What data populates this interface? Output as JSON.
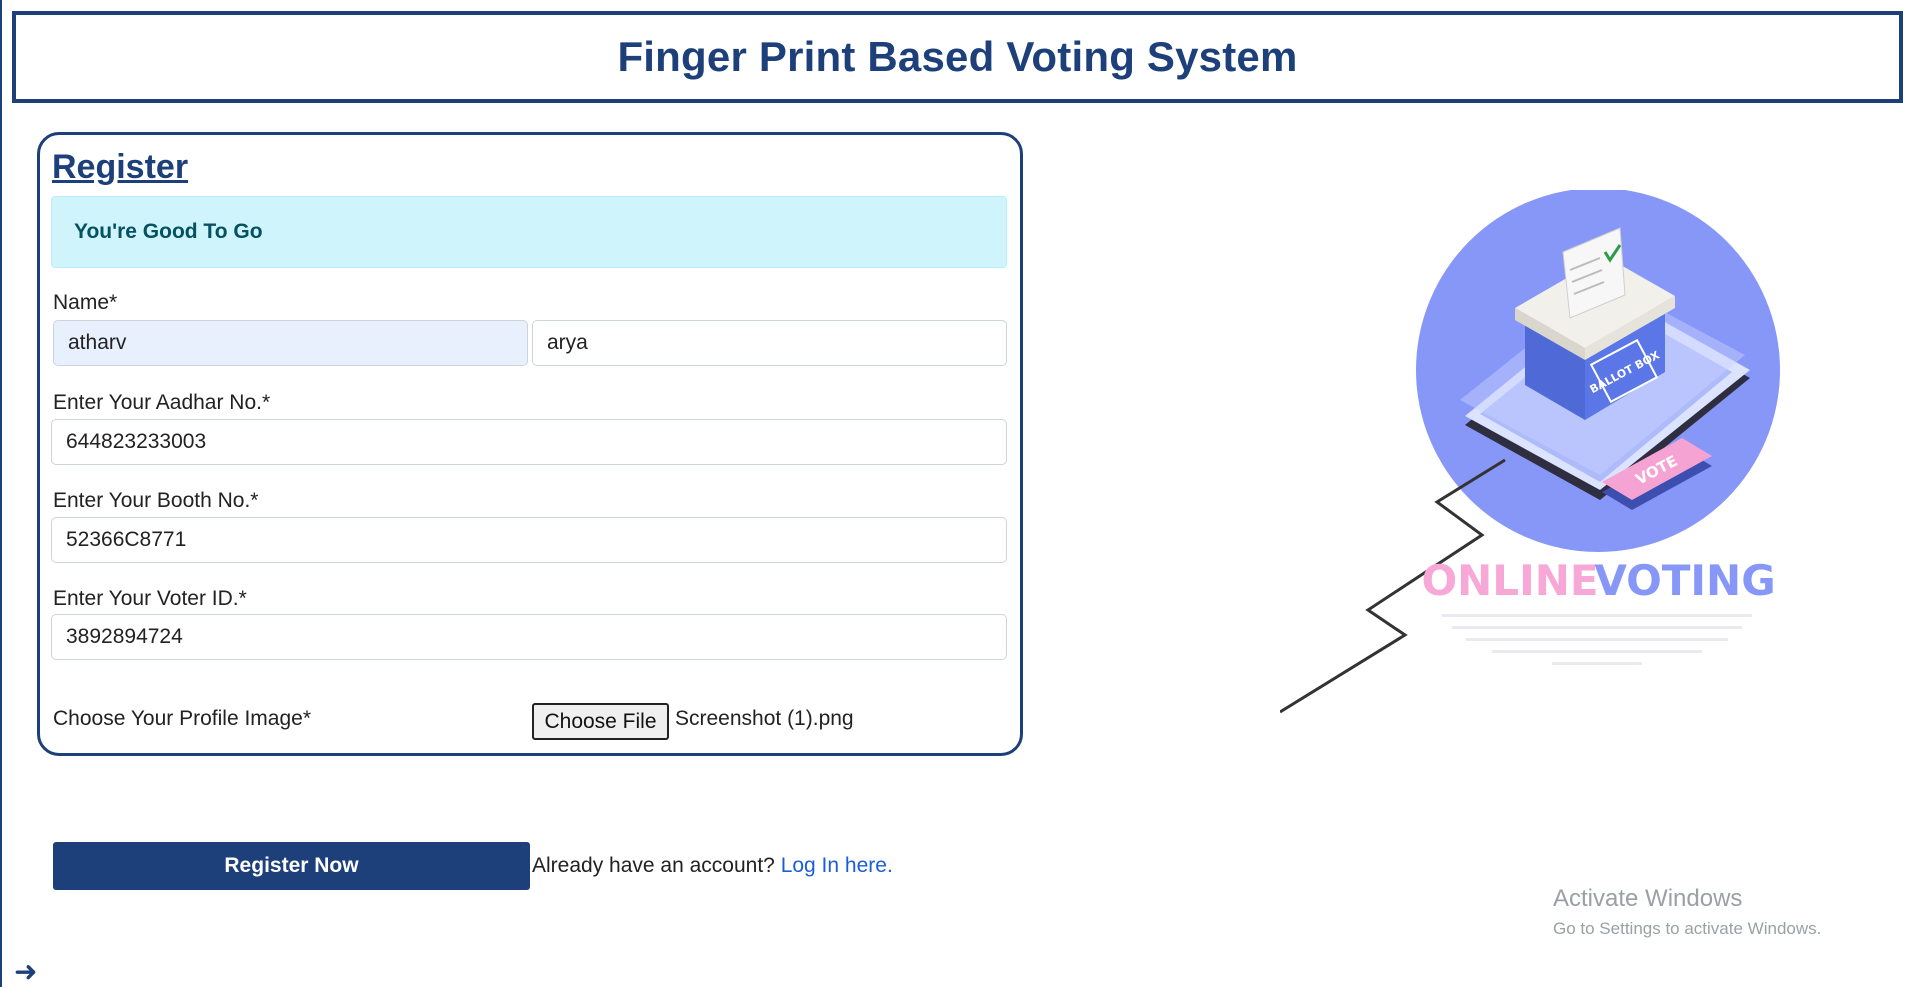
{
  "header": {
    "title": "Finger Print Based Voting System"
  },
  "form": {
    "title": "Register",
    "alert": "You're Good To Go",
    "name_label": "Name*",
    "first_name": "atharv",
    "last_name": "arya",
    "aadhar_label": "Enter Your Aadhar No.*",
    "aadhar_value": "644823233003",
    "booth_label": "Enter Your Booth No.*",
    "booth_value": "52366C8771",
    "voter_label": "Enter Your Voter ID.*",
    "voter_value": "3892894724",
    "image_label": "Choose Your Profile Image*",
    "choose_file_label": "Choose File",
    "file_name": "Screenshot (1).png"
  },
  "actions": {
    "register_label": "Register Now",
    "account_prompt": "Already have an account?",
    "login_link": "Log In here."
  },
  "illustration": {
    "ballot_text": "BALLOT BOX",
    "vote_text": "VOTE",
    "online_text": "ONLINE",
    "voting_text": "VOTING"
  },
  "watermark": {
    "title": "Activate Windows",
    "subtitle": "Go to Settings to activate Windows."
  },
  "colors": {
    "primary": "#1d3f7a",
    "alert_bg": "#cff4fc",
    "link": "#1a5ed8"
  },
  "icons": {
    "nav": "arrow-right-icon"
  }
}
